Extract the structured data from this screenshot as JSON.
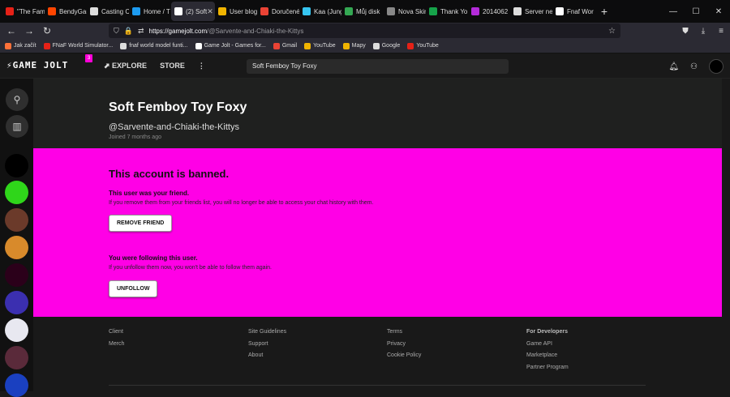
{
  "tabs": [
    {
      "title": "\"The Fam",
      "color": "#e62117"
    },
    {
      "title": "BendyGar",
      "color": "#ff4500"
    },
    {
      "title": "Casting C",
      "color": "#dddddd"
    },
    {
      "title": "Home / T",
      "color": "#1d9bf0"
    },
    {
      "title": "(2) Soft",
      "color": "#ffffff",
      "active": true
    },
    {
      "title": "User blog",
      "color": "#f0b400"
    },
    {
      "title": "Doručené",
      "color": "#ea4335"
    },
    {
      "title": "Kaa (Jung",
      "color": "#36c5f0"
    },
    {
      "title": "Můj disk",
      "color": "#34a853"
    },
    {
      "title": "Nova Skin",
      "color": "#888888"
    },
    {
      "title": "Thank Yo",
      "color": "#16a34a"
    },
    {
      "title": "2014062",
      "color": "#b42bd9"
    },
    {
      "title": "Server ne",
      "color": "#dddddd"
    },
    {
      "title": "Fnaf Wor",
      "color": "#ffffff"
    }
  ],
  "window_controls": {
    "minimize": "—",
    "maximize": "☐",
    "close": "✕"
  },
  "url": {
    "host": "https://gamejolt.com",
    "path": "/@Sarvente-and-Chiaki-the-Kittys"
  },
  "bookmarks": [
    {
      "label": "Jak začít",
      "color": "#ff7139"
    },
    {
      "label": "FNaF World Simulator...",
      "color": "#e62117"
    },
    {
      "label": "fnaf world model funti...",
      "color": "#dddddd"
    },
    {
      "label": "Game Jolt - Games for...",
      "color": "#ffffff"
    },
    {
      "label": "Gmail",
      "color": "#ea4335"
    },
    {
      "label": "YouTube",
      "color": "#f0b400"
    },
    {
      "label": "Mapy",
      "color": "#f0b400"
    },
    {
      "label": "Google",
      "color": "#dddddd"
    },
    {
      "label": "YouTube",
      "color": "#e62117"
    }
  ],
  "header": {
    "logo": "GAME JOLT",
    "badge": "3",
    "explore": "EXPLORE",
    "store": "STORE",
    "more": "⋮",
    "search": "Soft Femboy Toy Foxy"
  },
  "profile": {
    "name": "Soft Femboy Toy Foxy",
    "handle": "@Sarvente-and-Chiaki-the-Kittys",
    "joined": "Joined 7 months ago"
  },
  "ban": {
    "title": "This account is banned.",
    "friend_title": "This user was your friend.",
    "friend_desc": "If you remove them from your friends list, you will no longer be able to access your chat history with them.",
    "remove_label": "REMOVE FRIEND",
    "follow_title": "You were following this user.",
    "follow_desc": "If you unfollow them now, you won't be able to follow them again.",
    "unfollow_label": "UNFOLLOW"
  },
  "footer": {
    "col1": [
      "Client",
      "Merch"
    ],
    "col2": [
      "Site Guidelines",
      "Support",
      "About"
    ],
    "col3": [
      "Terms",
      "Privacy",
      "Cookie Policy"
    ],
    "col4_head": "For Developers",
    "col4": [
      "Game API",
      "Marketplace",
      "Partner Program"
    ]
  },
  "colors": {
    "ban_bg": "#ff00e6",
    "accent": "#ff00d8"
  }
}
